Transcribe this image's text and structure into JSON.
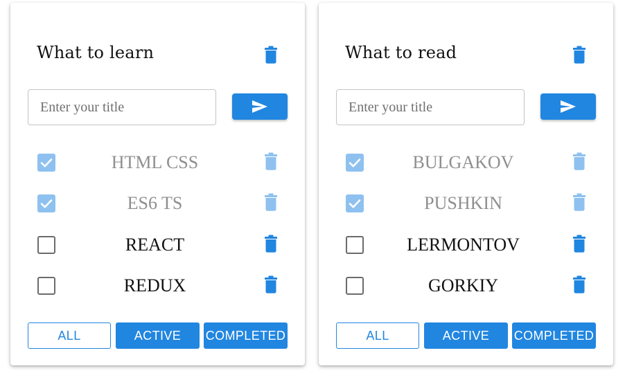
{
  "colors": {
    "accent": "#2186e0",
    "accent_faded": "#8ec1ef",
    "done_text": "#8f8f8f",
    "text": "#111111"
  },
  "todolists": [
    {
      "title": "What to learn",
      "input": {
        "placeholder": "Enter your title",
        "value": ""
      },
      "send_icon": "send-arrow-icon",
      "delete_icon": "trash-icon",
      "tasks": [
        {
          "title": "HTML CSS",
          "done": true
        },
        {
          "title": "ES6 TS",
          "done": true
        },
        {
          "title": "REACT",
          "done": false
        },
        {
          "title": "REDUX",
          "done": false
        }
      ],
      "filters": {
        "all": "ALL",
        "active": "ACTIVE",
        "completed": "COMPLETED",
        "selected": "all"
      }
    },
    {
      "title": "What to read",
      "input": {
        "placeholder": "Enter your title",
        "value": ""
      },
      "send_icon": "send-arrow-icon",
      "delete_icon": "trash-icon",
      "tasks": [
        {
          "title": "BULGAKOV",
          "done": true
        },
        {
          "title": "PUSHKIN",
          "done": true
        },
        {
          "title": "LERMONTOV",
          "done": false
        },
        {
          "title": "GORKIY",
          "done": false
        }
      ],
      "filters": {
        "all": "ALL",
        "active": "ACTIVE",
        "completed": "COMPLETED",
        "selected": "all"
      }
    }
  ]
}
